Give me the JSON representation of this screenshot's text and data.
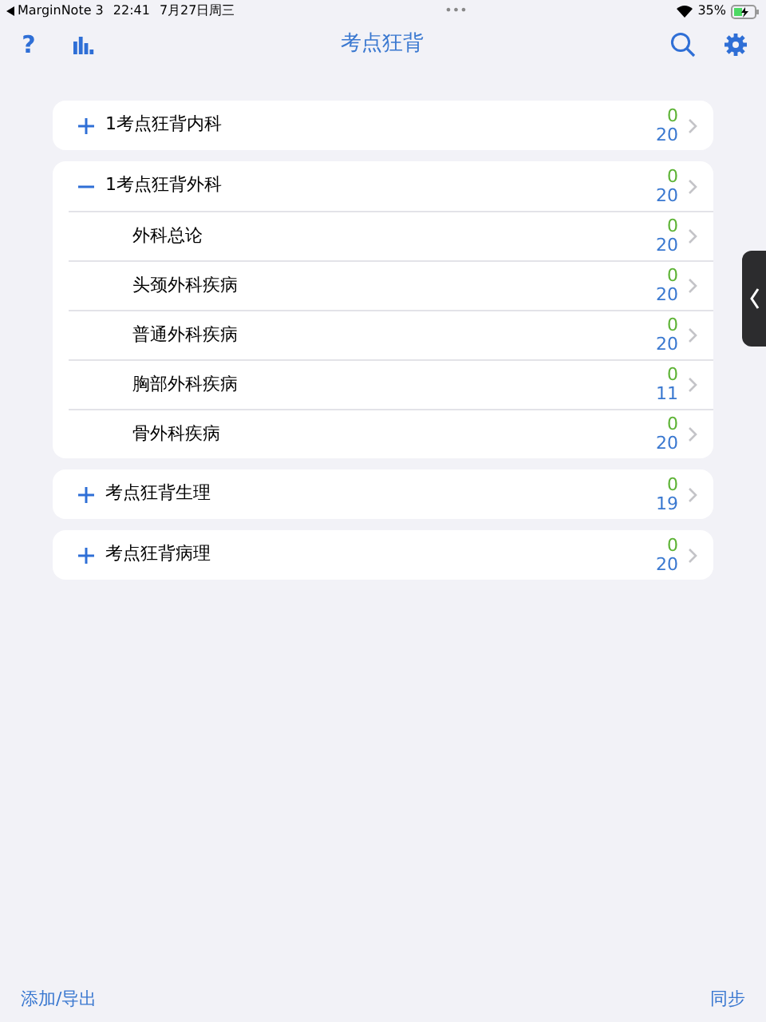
{
  "status_bar": {
    "back_app": "MarginNote 3",
    "time": "22:41",
    "date": "7月27日周三",
    "dots": "•••",
    "battery": "35%"
  },
  "nav_bar": {
    "help": "?",
    "title": "考点狂背"
  },
  "groups": [
    {
      "title": "1考点狂背内科",
      "expanded": false,
      "done": "0",
      "total": "20"
    },
    {
      "title": "1考点狂背外科",
      "expanded": true,
      "done": "0",
      "total": "20",
      "children": [
        {
          "title": "外科总论",
          "done": "0",
          "total": "20"
        },
        {
          "title": "头颈外科疾病",
          "done": "0",
          "total": "20"
        },
        {
          "title": "普通外科疾病",
          "done": "0",
          "total": "20"
        },
        {
          "title": "胸部外科疾病",
          "done": "0",
          "total": "11"
        },
        {
          "title": "骨外科疾病",
          "done": "0",
          "total": "20"
        }
      ]
    },
    {
      "title": "考点狂背生理",
      "expanded": false,
      "done": "0",
      "total": "19"
    },
    {
      "title": "考点狂背病理",
      "expanded": false,
      "done": "0",
      "total": "20"
    }
  ],
  "toolbar": {
    "left": "添加/导出",
    "right": "同步"
  }
}
